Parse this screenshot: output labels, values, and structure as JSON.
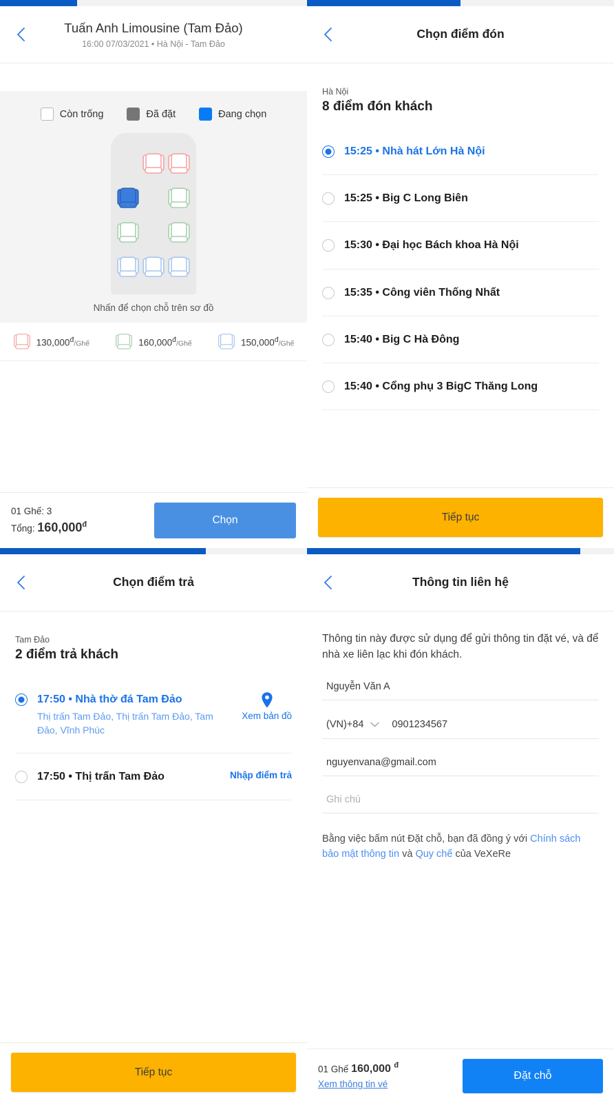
{
  "theme": {
    "blue": "#0a5bc4",
    "accent_blue": "#1a73e8",
    "button_blue": "#4a90e2",
    "amber": "#fdb200",
    "seat_red": "#f5a3a3",
    "seat_green": "#a8cfae",
    "seat_blue": "#a8c6ee",
    "seat_selected": "#3b7ddd",
    "seat_taken": "#767676"
  },
  "panel_seat": {
    "progress_percent": 25,
    "back_icon": "chevron-left-icon",
    "title": "Tuấn Anh Limousine (Tam Đảo)",
    "subtitle": "16:00 07/03/2021 • Hà Nội - Tam Đảo",
    "legend": [
      {
        "label": "Còn trống",
        "state": "empty"
      },
      {
        "label": "Đã đặt",
        "state": "taken"
      },
      {
        "label": "Đang chọn",
        "state": "picked"
      }
    ],
    "seat_rows": [
      [
        {
          "type": "none"
        },
        {
          "type": "red"
        },
        {
          "type": "red"
        }
      ],
      [
        {
          "type": "selected"
        },
        {
          "type": "none"
        },
        {
          "type": "green"
        }
      ],
      [
        {
          "type": "green"
        },
        {
          "type": "none"
        },
        {
          "type": "green"
        }
      ],
      [
        {
          "type": "blue"
        },
        {
          "type": "blue"
        },
        {
          "type": "blue"
        }
      ]
    ],
    "hint": "Nhấn để chọn chỗ trên sơ đồ",
    "prices": [
      {
        "type": "red",
        "amount": "130,000",
        "currency": "đ",
        "per": "/Ghế"
      },
      {
        "type": "green",
        "amount": "160,000",
        "currency": "đ",
        "per": "/Ghế"
      },
      {
        "type": "blue",
        "amount": "150,000",
        "currency": "đ",
        "per": "/Ghế"
      }
    ],
    "summary_seats": "01 Ghế: 3",
    "summary_total_label": "Tổng:",
    "summary_total_value": "160,000",
    "summary_currency": "đ",
    "cta_label": "Chọn"
  },
  "panel_pickup": {
    "progress_percent": 50,
    "back_icon": "chevron-left-icon",
    "title": "Chọn điểm đón",
    "city": "Hà Nội",
    "count_label": "8 điểm đón khách",
    "points": [
      {
        "time": "15:25",
        "name": "Nhà hát Lớn Hà Nội",
        "selected": true
      },
      {
        "time": "15:25",
        "name": "Big C Long Biên",
        "selected": false
      },
      {
        "time": "15:30",
        "name": "Đại học Bách khoa Hà Nội",
        "selected": false
      },
      {
        "time": "15:35",
        "name": "Công viên Thống Nhất",
        "selected": false
      },
      {
        "time": "15:40",
        "name": "Big C Hà Đông",
        "selected": false
      },
      {
        "time": "15:40",
        "name": "Cổng phụ 3 BigC Thăng Long",
        "selected": false
      }
    ],
    "cta_label": "Tiếp tục"
  },
  "panel_dropoff": {
    "progress_percent": 67,
    "back_icon": "chevron-left-icon",
    "title": "Chọn điểm trả",
    "city": "Tam Đảo",
    "count_label": "2 điểm trả khách",
    "points": [
      {
        "time": "17:50",
        "name": "Nhà thờ đá Tam Đảo",
        "address": "Thị trấn Tam Đảo, Thị trấn Tam Đảo, Tam Đảo, Vĩnh Phúc",
        "selected": true,
        "side_action": "Xem bản đồ",
        "side_icon": "map-pin-icon"
      },
      {
        "time": "17:50",
        "name": "Thị trấn Tam Đảo",
        "address": "",
        "selected": false,
        "side_action": "Nhập điểm trả",
        "side_icon": ""
      }
    ],
    "cta_label": "Tiếp tục"
  },
  "panel_contact": {
    "progress_percent": 89,
    "back_icon": "chevron-left-icon",
    "title": "Thông tin liên hệ",
    "note": "Thông tin này được sử dụng để gửi thông tin đặt vé, và để nhà xe liên lạc khi đón khách.",
    "name_value": "Nguyễn Văn A",
    "country_code": "(VN)+84",
    "country_chevron": "chevron-down-icon",
    "phone_value": "0901234567",
    "email_value": "nguyenvana@gmail.com",
    "note_placeholder": "Ghi chú",
    "terms_prefix": "Bằng việc bấm nút Đặt chỗ, bạn đã đồng ý với ",
    "terms_link1": "Chính sách bảo mật thông tin",
    "terms_mid": " và ",
    "terms_link2": "Quy chế",
    "terms_suffix": " của VeXeRe",
    "summary_seats_label": "01 Ghế",
    "summary_amount": "160,000",
    "summary_currency": "đ",
    "summary_link": "Xem thông tin vé",
    "cta_label": "Đặt chỗ"
  }
}
